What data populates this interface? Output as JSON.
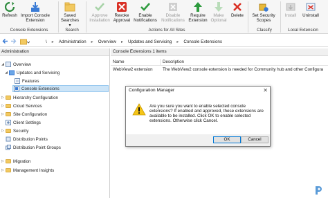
{
  "ribbon": {
    "buttons": [
      {
        "label": "Refresh",
        "disabled": false,
        "icon": "refresh-icon"
      },
      {
        "label": "Import Console\nExtension",
        "disabled": false,
        "icon": "import-extension-icon"
      },
      {
        "label": "Saved\nSearches ▾",
        "disabled": false,
        "icon": "saved-searches-icon"
      },
      {
        "label": "Approve\nInstallation",
        "disabled": true,
        "icon": "approve-installation-icon"
      },
      {
        "label": "Revoke\nApproval",
        "disabled": false,
        "icon": "revoke-approval-icon"
      },
      {
        "label": "Enable\nNotifications",
        "disabled": false,
        "icon": "enable-notifications-icon"
      },
      {
        "label": "Disable\nNotifications",
        "disabled": true,
        "icon": "disable-notifications-icon"
      },
      {
        "label": "Require\nExtension",
        "disabled": false,
        "icon": "require-extension-icon"
      },
      {
        "label": "Make\nOptional",
        "disabled": true,
        "icon": "make-optional-icon"
      },
      {
        "label": "Delete",
        "disabled": false,
        "icon": "delete-icon"
      },
      {
        "label": "Set Security\nScopes",
        "disabled": false,
        "icon": "set-security-scopes-icon"
      },
      {
        "label": "Install",
        "disabled": true,
        "icon": "install-icon"
      },
      {
        "label": "Uninstall",
        "disabled": false,
        "icon": "uninstall-icon"
      }
    ],
    "groups": [
      "Console Extensions",
      "Search",
      "Actions for All Sites",
      "Classify",
      "Local Extension"
    ]
  },
  "address": {
    "root": "\\",
    "crumbs": [
      "Administration",
      "Overview",
      "Updates and Servicing",
      "Console Extensions"
    ]
  },
  "nav": {
    "header": "Administration",
    "items": [
      {
        "label": "Overview"
      },
      {
        "label": "Updates and Servicing"
      },
      {
        "label": "Features"
      },
      {
        "label": "Console Extensions"
      },
      {
        "label": "Hierarchy Configuration"
      },
      {
        "label": "Cloud Services"
      },
      {
        "label": "Site Configuration"
      },
      {
        "label": "Client Settings"
      },
      {
        "label": "Security"
      },
      {
        "label": "Distribution Points"
      },
      {
        "label": "Distribution Point Groups"
      },
      {
        "label": "Migration"
      },
      {
        "label": "Management Insights"
      }
    ]
  },
  "content": {
    "header": "Console Extensions 1 items",
    "columns": [
      "Name",
      "Description"
    ],
    "rows": [
      {
        "name": "WebView2 extension",
        "description": "The WebView2 console extension is needed for Community hub and other Configura"
      }
    ]
  },
  "dialog": {
    "title": "Configuration Manager",
    "message": "Are you sure you want to enable selected console extensions? If enabled and approved, these extensions are available to be installed. Click OK to enable selected extensions. Otherwise click Cancel.",
    "ok_label": "OK",
    "cancel_label": "Cancel",
    "close_glyph": "✕"
  },
  "colors": {
    "accent": "#0078d7",
    "selection": "#cce4f7",
    "folder": "#f2c960",
    "warning": "#f5c518"
  }
}
